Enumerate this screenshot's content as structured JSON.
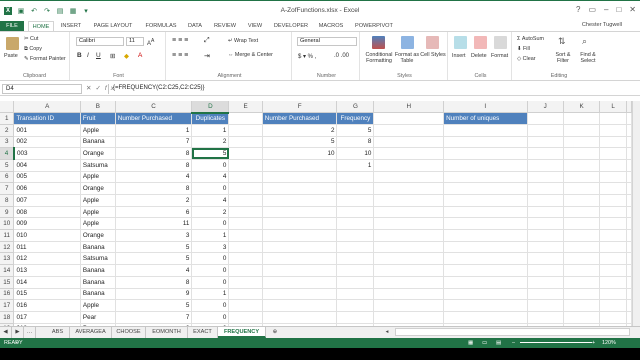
{
  "window": {
    "title": "A-ZofFunctions.xlsx - Excel",
    "user": "Chester Tugwell"
  },
  "ribbon_tabs": [
    "FILE",
    "HOME",
    "INSERT",
    "PAGE LAYOUT",
    "FORMULAS",
    "DATA",
    "REVIEW",
    "VIEW",
    "DEVELOPER",
    "MACROS",
    "POWERPIVOT"
  ],
  "ribbon": {
    "clipboard": {
      "paste": "Paste",
      "cut": "Cut",
      "copy": "Copy",
      "format_painter": "Format Painter",
      "label": "Clipboard"
    },
    "font": {
      "name": "Calibri",
      "size": "11",
      "label": "Font"
    },
    "alignment": {
      "wrap": "Wrap Text",
      "merge": "Merge & Center",
      "label": "Alignment"
    },
    "number": {
      "format": "General",
      "label": "Number"
    },
    "styles": {
      "cond": "Conditional Formatting",
      "table": "Format as Table",
      "cell": "Cell Styles",
      "label": "Styles"
    },
    "cells": {
      "insert": "Insert",
      "delete": "Delete",
      "format": "Format",
      "label": "Cells"
    },
    "editing": {
      "autosum": "AutoSum",
      "fill": "Fill",
      "clear": "Clear",
      "sort": "Sort & Filter",
      "find": "Find & Select",
      "label": "Editing"
    }
  },
  "formula_bar": {
    "name_box": "D4",
    "formula": "{=FREQUENCY(C2:C25,C2:C25)}"
  },
  "columns": [
    "A",
    "B",
    "C",
    "D",
    "E",
    "F",
    "G",
    "H",
    "I",
    "J",
    "K",
    "L"
  ],
  "rows": [
    [
      "Transation ID",
      "Fruit",
      "Number Purchased",
      "Duplicates",
      "",
      "Number Purchased",
      "Frequency",
      "",
      "Number of uniques",
      "",
      "",
      ""
    ],
    [
      "001",
      "Apple",
      "1",
      "1",
      "",
      "2",
      "5",
      "",
      "",
      "",
      "",
      ""
    ],
    [
      "002",
      "Banana",
      "7",
      "2",
      "",
      "5",
      "8",
      "",
      "",
      "",
      "",
      ""
    ],
    [
      "003",
      "Orange",
      "8",
      "5",
      "",
      "10",
      "10",
      "",
      "",
      "",
      "",
      ""
    ],
    [
      "004",
      "Satsuma",
      "8",
      "0",
      "",
      "",
      "1",
      "",
      "",
      "",
      "",
      ""
    ],
    [
      "005",
      "Apple",
      "4",
      "4",
      "",
      "",
      "",
      "",
      "",
      "",
      "",
      ""
    ],
    [
      "006",
      "Orange",
      "8",
      "0",
      "",
      "",
      "",
      "",
      "",
      "",
      "",
      ""
    ],
    [
      "007",
      "Apple",
      "2",
      "4",
      "",
      "",
      "",
      "",
      "",
      "",
      "",
      ""
    ],
    [
      "008",
      "Apple",
      "6",
      "2",
      "",
      "",
      "",
      "",
      "",
      "",
      "",
      ""
    ],
    [
      "009",
      "Apple",
      "11",
      "0",
      "",
      "",
      "",
      "",
      "",
      "",
      "",
      ""
    ],
    [
      "010",
      "Orange",
      "3",
      "1",
      "",
      "",
      "",
      "",
      "",
      "",
      "",
      ""
    ],
    [
      "011",
      "Banana",
      "5",
      "3",
      "",
      "",
      "",
      "",
      "",
      "",
      "",
      ""
    ],
    [
      "012",
      "Satsuma",
      "5",
      "0",
      "",
      "",
      "",
      "",
      "",
      "",
      "",
      ""
    ],
    [
      "013",
      "Banana",
      "4",
      "0",
      "",
      "",
      "",
      "",
      "",
      "",
      "",
      ""
    ],
    [
      "014",
      "Banana",
      "8",
      "0",
      "",
      "",
      "",
      "",
      "",
      "",
      "",
      ""
    ],
    [
      "015",
      "Banana",
      "9",
      "1",
      "",
      "",
      "",
      "",
      "",
      "",
      "",
      ""
    ],
    [
      "016",
      "Apple",
      "5",
      "0",
      "",
      "",
      "",
      "",
      "",
      "",
      "",
      ""
    ],
    [
      "017",
      "Pear",
      "7",
      "0",
      "",
      "",
      "",
      "",
      "",
      "",
      "",
      ""
    ],
    [
      "018",
      "Pear",
      "2",
      "0",
      "",
      "",
      "",
      "",
      "",
      "",
      "",
      ""
    ]
  ],
  "sheet_tabs": [
    "ABS",
    "AVERAGEA",
    "CHOOSE",
    "EOMONTH",
    "EXACT",
    "FREQUENCY"
  ],
  "active_sheet": "FREQUENCY",
  "status": {
    "mode": "READY",
    "zoom": "120%"
  },
  "colors": {
    "excel_green": "#217346",
    "header_blue": "#4f81bd"
  }
}
